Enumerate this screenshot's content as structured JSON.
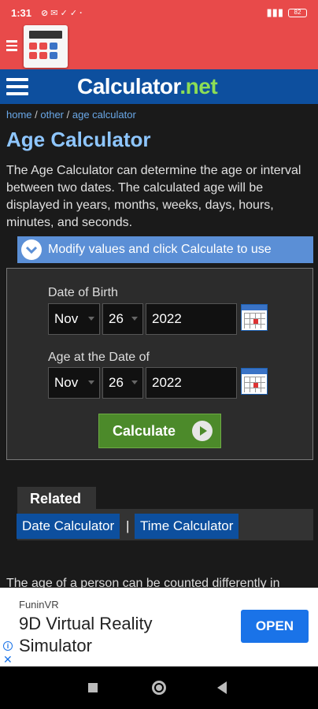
{
  "status": {
    "time": "1:31",
    "icons": "⊘ ✉ ✓ ✓ ·",
    "signal": "▮▮▮",
    "battery": "82"
  },
  "site": {
    "brand": "Calculator",
    "brand_suffix": ".net"
  },
  "breadcrumb": {
    "home": "home",
    "sep1": " / ",
    "other": "other",
    "sep2": " / ",
    "current": "age calculator"
  },
  "page": {
    "title": "Age Calculator",
    "intro": "The Age Calculator can determine the age or interval between two dates. The calculated age will be displayed in years, months, weeks, days, hours, minutes, and seconds."
  },
  "modify_bar": {
    "text": "Modify values and click Calculate to use"
  },
  "form": {
    "dob_label": "Date of Birth",
    "dob_month": "Nov",
    "dob_day": "26",
    "dob_year": "2022",
    "at_label": "Age at the Date of",
    "at_month": "Nov",
    "at_day": "26",
    "at_year": "2022",
    "calculate_label": "Calculate"
  },
  "related": {
    "title": "Related",
    "link1": "Date Calculator",
    "separator": "|",
    "link2": "Time Calculator"
  },
  "paragraph_cut": "The age of a person can be counted differently in",
  "ad": {
    "brand": "FuninVR",
    "title": "9D Virtual Reality Simulator",
    "cta": "OPEN"
  },
  "colors": {
    "app_header": "#e84a4a",
    "site_header": "#0d4f9e",
    "brand_accent": "#8cdd56",
    "calculate": "#4c8a2a"
  }
}
